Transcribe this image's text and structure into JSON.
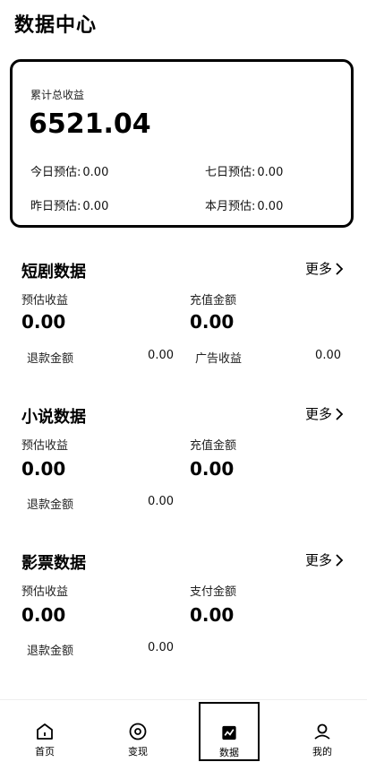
{
  "page_title": "数据中心",
  "summary": {
    "label": "累计总收益",
    "amount": "6521.04",
    "stats": [
      {
        "label": "今日预估:",
        "value": "0.00"
      },
      {
        "label": "七日预估:",
        "value": "0.00"
      },
      {
        "label": "昨日预估:",
        "value": "0.00"
      },
      {
        "label": "本月预估:",
        "value": "0.00"
      }
    ]
  },
  "sections": [
    {
      "title": "短剧数据",
      "more": "更多",
      "metrics": [
        {
          "label": "预估收益",
          "value": "0.00"
        },
        {
          "label": "充值金额",
          "value": "0.00"
        }
      ],
      "minor": [
        {
          "label": "退款金额",
          "value": "0.00"
        },
        {
          "label": "广告收益",
          "value": "0.00"
        }
      ]
    },
    {
      "title": "小说数据",
      "more": "更多",
      "metrics": [
        {
          "label": "预估收益",
          "value": "0.00"
        },
        {
          "label": "充值金额",
          "value": "0.00"
        }
      ],
      "minor": [
        {
          "label": "退款金额",
          "value": "0.00"
        }
      ]
    },
    {
      "title": "影票数据",
      "more": "更多",
      "metrics": [
        {
          "label": "预估收益",
          "value": "0.00"
        },
        {
          "label": "支付金额",
          "value": "0.00"
        }
      ],
      "minor": [
        {
          "label": "退款金额",
          "value": "0.00"
        }
      ]
    }
  ],
  "tabbar": [
    {
      "label": "首页",
      "icon": "home-icon"
    },
    {
      "label": "变现",
      "icon": "target-icon"
    },
    {
      "label": "数据",
      "icon": "chart-icon",
      "active": true
    },
    {
      "label": "我的",
      "icon": "user-icon"
    }
  ]
}
